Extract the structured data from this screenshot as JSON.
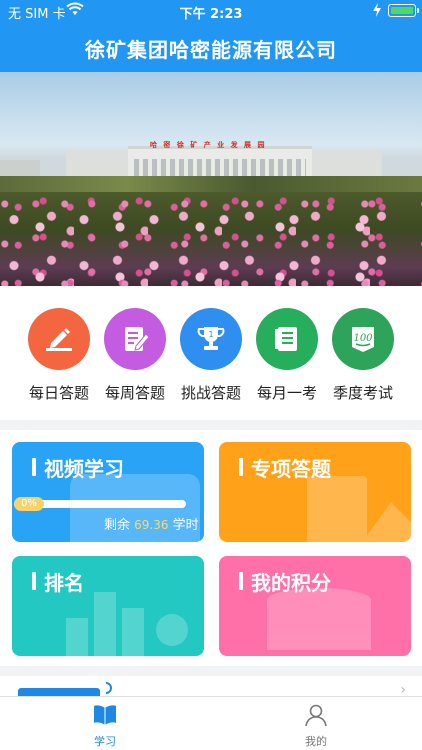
{
  "status_bar": {
    "carrier": "无 SIM 卡",
    "time": "下午 2:23"
  },
  "header": {
    "title": "徐矿集团哈密能源有限公司"
  },
  "banner": {
    "sign_text": "哈 密 徐 矿 产 业 发 展 园",
    "slide_count": 5,
    "active_slide": 4
  },
  "quick_menu": [
    {
      "label": "每日答题",
      "icon": "pencil-edit-icon",
      "color": "#f4663f"
    },
    {
      "label": "每周答题",
      "icon": "notepad-pen-icon",
      "color": "#c35ce0"
    },
    {
      "label": "挑战答题",
      "icon": "trophy-icon",
      "color": "#2f8ff0"
    },
    {
      "label": "每月一考",
      "icon": "checklist-book-icon",
      "color": "#27ae5d"
    },
    {
      "label": "季度考试",
      "icon": "score-100-icon",
      "color": "#2ea35a"
    }
  ],
  "cards": {
    "video": {
      "title": "视频学习",
      "progress_label": "0%",
      "progress": 0,
      "remain_prefix": "剩余",
      "remain_value": "69.36",
      "remain_unit": "学时",
      "color": "#29a3f6"
    },
    "special": {
      "title": "专项答题",
      "color": "#ffa21a"
    },
    "ranking": {
      "title": "排名",
      "color": "#23c8c2"
    },
    "points": {
      "title": "我的积分",
      "color": "#ff6fa8"
    }
  },
  "tabbar": {
    "items": [
      {
        "label": "学习",
        "icon": "book-icon",
        "active": true
      },
      {
        "label": "我的",
        "icon": "user-icon",
        "active": false
      }
    ],
    "active_color": "#1e88e5",
    "inactive_color": "#777777"
  }
}
